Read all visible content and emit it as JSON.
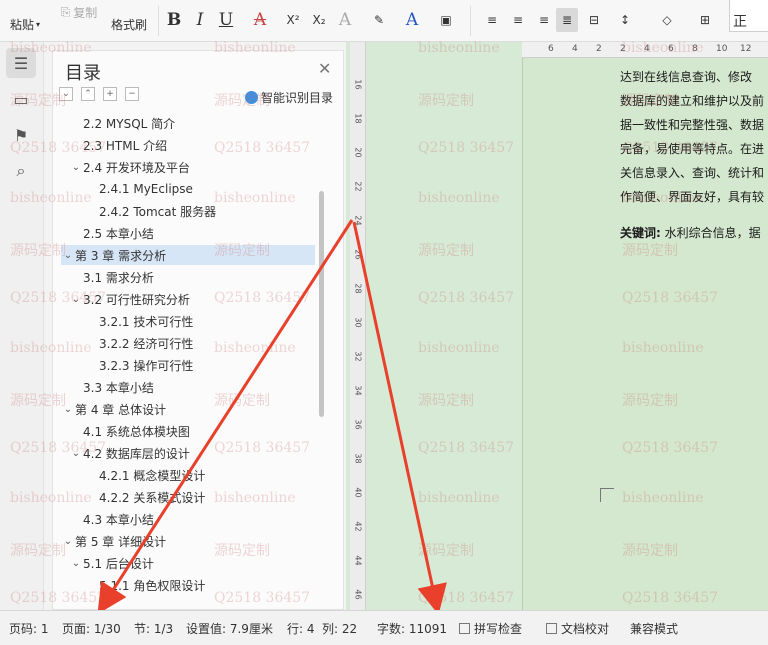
{
  "ribbon": {
    "paste": "粘贴",
    "copy": "复制",
    "format_painter": "格式刷",
    "bold": "B",
    "italic": "I",
    "underline": "U",
    "font_color_a": "A",
    "superscript": "X²",
    "subscript": "X₂",
    "style_preview": "正"
  },
  "sidebar_icons": [
    "toc-icon",
    "folder-icon",
    "bookmark-icon",
    "search-icon"
  ],
  "toc": {
    "title": "目录",
    "smart_button": "智能识别目录",
    "items": [
      {
        "label": "2.2 MYSQL 简介",
        "level": 2,
        "chev": ""
      },
      {
        "label": "2.3 HTML 介绍",
        "level": 2,
        "chev": ""
      },
      {
        "label": "2.4 开发环境及平台",
        "level": 2,
        "chev": "v"
      },
      {
        "label": "2.4.1 MyEclipse",
        "level": 3,
        "chev": ""
      },
      {
        "label": "2.4.2 Tomcat 服务器",
        "level": 3,
        "chev": ""
      },
      {
        "label": "2.5 本章小结",
        "level": 2,
        "chev": ""
      },
      {
        "label": "第 3 章 需求分析",
        "level": 1,
        "chev": "v",
        "selected": true
      },
      {
        "label": "3.1 需求分析",
        "level": 2,
        "chev": ""
      },
      {
        "label": "3.2 可行性研究分析",
        "level": 2,
        "chev": "v"
      },
      {
        "label": "3.2.1 技术可行性",
        "level": 3,
        "chev": ""
      },
      {
        "label": "3.2.2 经济可行性",
        "level": 3,
        "chev": ""
      },
      {
        "label": "3.2.3 操作可行性",
        "level": 3,
        "chev": ""
      },
      {
        "label": "3.3 本章小结",
        "level": 2,
        "chev": ""
      },
      {
        "label": "第 4 章 总体设计",
        "level": 1,
        "chev": "v"
      },
      {
        "label": "4.1 系统总体模块图",
        "level": 2,
        "chev": ""
      },
      {
        "label": "4.2 数据库层的设计",
        "level": 2,
        "chev": "v"
      },
      {
        "label": "4.2.1 概念模型设计",
        "level": 3,
        "chev": ""
      },
      {
        "label": "4.2.2 关系模式设计",
        "level": 3,
        "chev": ""
      },
      {
        "label": "4.3 本章小结",
        "level": 2,
        "chev": ""
      },
      {
        "label": "第 5 章 详细设计",
        "level": 1,
        "chev": "v"
      },
      {
        "label": "5.1 后台设计",
        "level": 2,
        "chev": "v"
      },
      {
        "label": "5.1.1 角色权限设计",
        "level": 3,
        "chev": ""
      }
    ]
  },
  "rulers": {
    "horizontal": [
      "6",
      "4",
      "2",
      "2",
      "4",
      "6",
      "8",
      "10",
      "12"
    ],
    "vertical": [
      "16",
      "18",
      "20",
      "22",
      "24",
      "26",
      "28",
      "30",
      "32",
      "34",
      "36",
      "38",
      "40",
      "42",
      "44",
      "46"
    ]
  },
  "document": {
    "lines": [
      "达到在线信息查询、修改",
      "数据库的建立和维护以及前",
      "据一致性和完整性强、数据",
      "完备，易使用等特点。在进",
      "关信息录入、查询、统计和",
      "作简便、界面友好，具有较"
    ],
    "keywords_label": "关键词:",
    "keywords_text": "水利综合信息，据"
  },
  "watermark": {
    "line1": "bisheonline",
    "line2": "源码定制",
    "line3": "Q2518 36457"
  },
  "status": {
    "page_code": "页码: 1",
    "page": "页面: 1/30",
    "section": "节: 1/3",
    "setting": "设置值: 7.9厘米",
    "row": "行: 4",
    "col": "列: 22",
    "word_count": "字数: 11091",
    "spell_check": "拼写检查",
    "doc_proofread": "文档校对",
    "compat_mode": "兼容模式"
  },
  "colors": {
    "accent_blue": "#3d8fe0",
    "doc_green": "#d4e8cf",
    "annotation_red": "#e8402a",
    "selection": "#d7e6f6"
  }
}
